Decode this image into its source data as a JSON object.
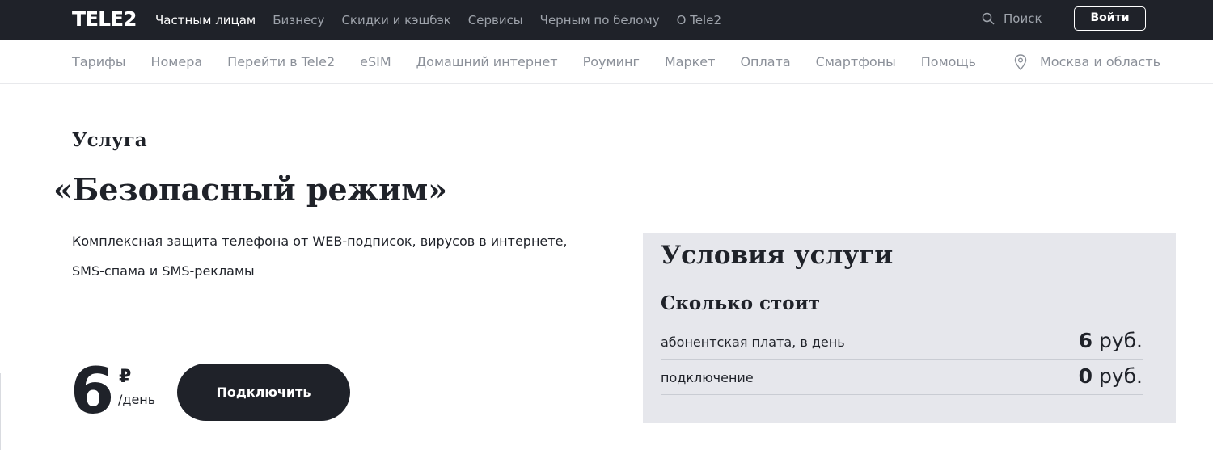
{
  "brand": {
    "logo": "TELE2"
  },
  "topnav": {
    "items": [
      {
        "label": "Частным лицам",
        "active": true
      },
      {
        "label": "Бизнесу",
        "active": false
      },
      {
        "label": "Скидки и кэшбэк",
        "active": false
      },
      {
        "label": "Сервисы",
        "active": false
      },
      {
        "label": "Черным по белому",
        "active": false
      },
      {
        "label": "О Tele2",
        "active": false
      }
    ],
    "search_label": "Поиск",
    "search_icon": "search-icon",
    "login_label": "Войти"
  },
  "subnav": {
    "items": [
      "Тарифы",
      "Номера",
      "Перейти в Tele2",
      "eSIM",
      "Домашний интернет",
      "Роуминг",
      "Маркет",
      "Оплата",
      "Смартфоны",
      "Помощь"
    ],
    "region_icon": "location-pin-icon",
    "region_label": "Москва и область"
  },
  "hero": {
    "eyebrow": "Услуга",
    "title": "«Безопасный режим»",
    "description_line1": "Комплексная защита телефона от WEB-подписок, вирусов в интернете,",
    "description_line2": "SMS-спама и SMS-рекламы",
    "price_value": "6",
    "price_currency": "₽",
    "price_period": "/день",
    "connect_label": "Подключить"
  },
  "conditions": {
    "title": "Условия услуги",
    "subtitle": "Сколько стоит",
    "rows": [
      {
        "label": "абонентская плата, в день",
        "amount": "6",
        "unit": "руб."
      },
      {
        "label": "подключение",
        "amount": "0",
        "unit": "руб."
      }
    ]
  },
  "colors": {
    "dark": "#1f2229",
    "muted_text": "#8b9099",
    "panel_bg": "#e6e7ec"
  }
}
